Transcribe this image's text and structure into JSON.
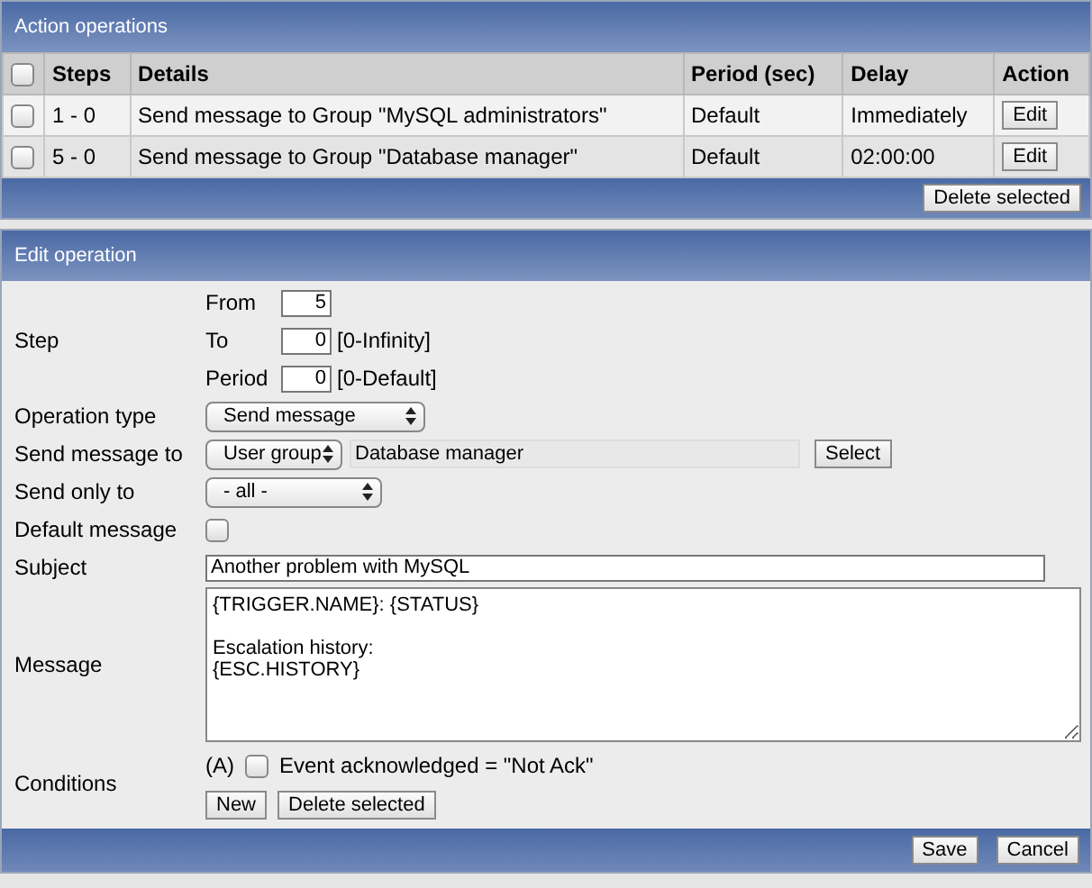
{
  "action_operations": {
    "title": "Action operations",
    "select_all": {
      "checked": false
    },
    "columns": [
      "Steps",
      "Details",
      "Period (sec)",
      "Delay",
      "Action"
    ],
    "rows": [
      {
        "checked": false,
        "steps": "1 - 0",
        "details": "Send message to Group \"MySQL administrators\"",
        "period": "Default",
        "delay": "Immediately",
        "action": "Edit"
      },
      {
        "checked": false,
        "steps": "5 - 0",
        "details": "Send message to Group \"Database manager\"",
        "period": "Default",
        "delay": "02:00:00",
        "action": "Edit"
      }
    ],
    "delete_button": "Delete selected"
  },
  "edit_operation": {
    "title": "Edit operation",
    "step": {
      "label": "Step",
      "fields": [
        {
          "label": "From",
          "value": "5"
        },
        {
          "label": "To",
          "value": "0",
          "hint": "[0-Infinity]"
        },
        {
          "label": "Period",
          "value": "0",
          "hint": "[0-Default]"
        }
      ]
    },
    "operation_type": {
      "label": "Operation type",
      "value": "Send message"
    },
    "send_message_to": {
      "label": "Send message to",
      "type": "User group",
      "value": "Database manager",
      "button": "Select"
    },
    "send_only_to": {
      "label": "Send only to",
      "value": "- all -"
    },
    "default_message": {
      "label": "Default message",
      "checked": false
    },
    "subject": {
      "label": "Subject",
      "value": "Another problem with MySQL"
    },
    "message": {
      "label": "Message",
      "value": "{TRIGGER.NAME}: {STATUS}\n\nEscalation history:\n{ESC.HISTORY}"
    },
    "conditions": {
      "label": "Conditions",
      "items": [
        {
          "tag": "(A)",
          "checked": false,
          "text": "Event acknowledged = \"Not Ack\""
        }
      ],
      "buttons": [
        "New",
        "Delete selected"
      ]
    },
    "footer_buttons": [
      "Save",
      "Cancel"
    ]
  }
}
